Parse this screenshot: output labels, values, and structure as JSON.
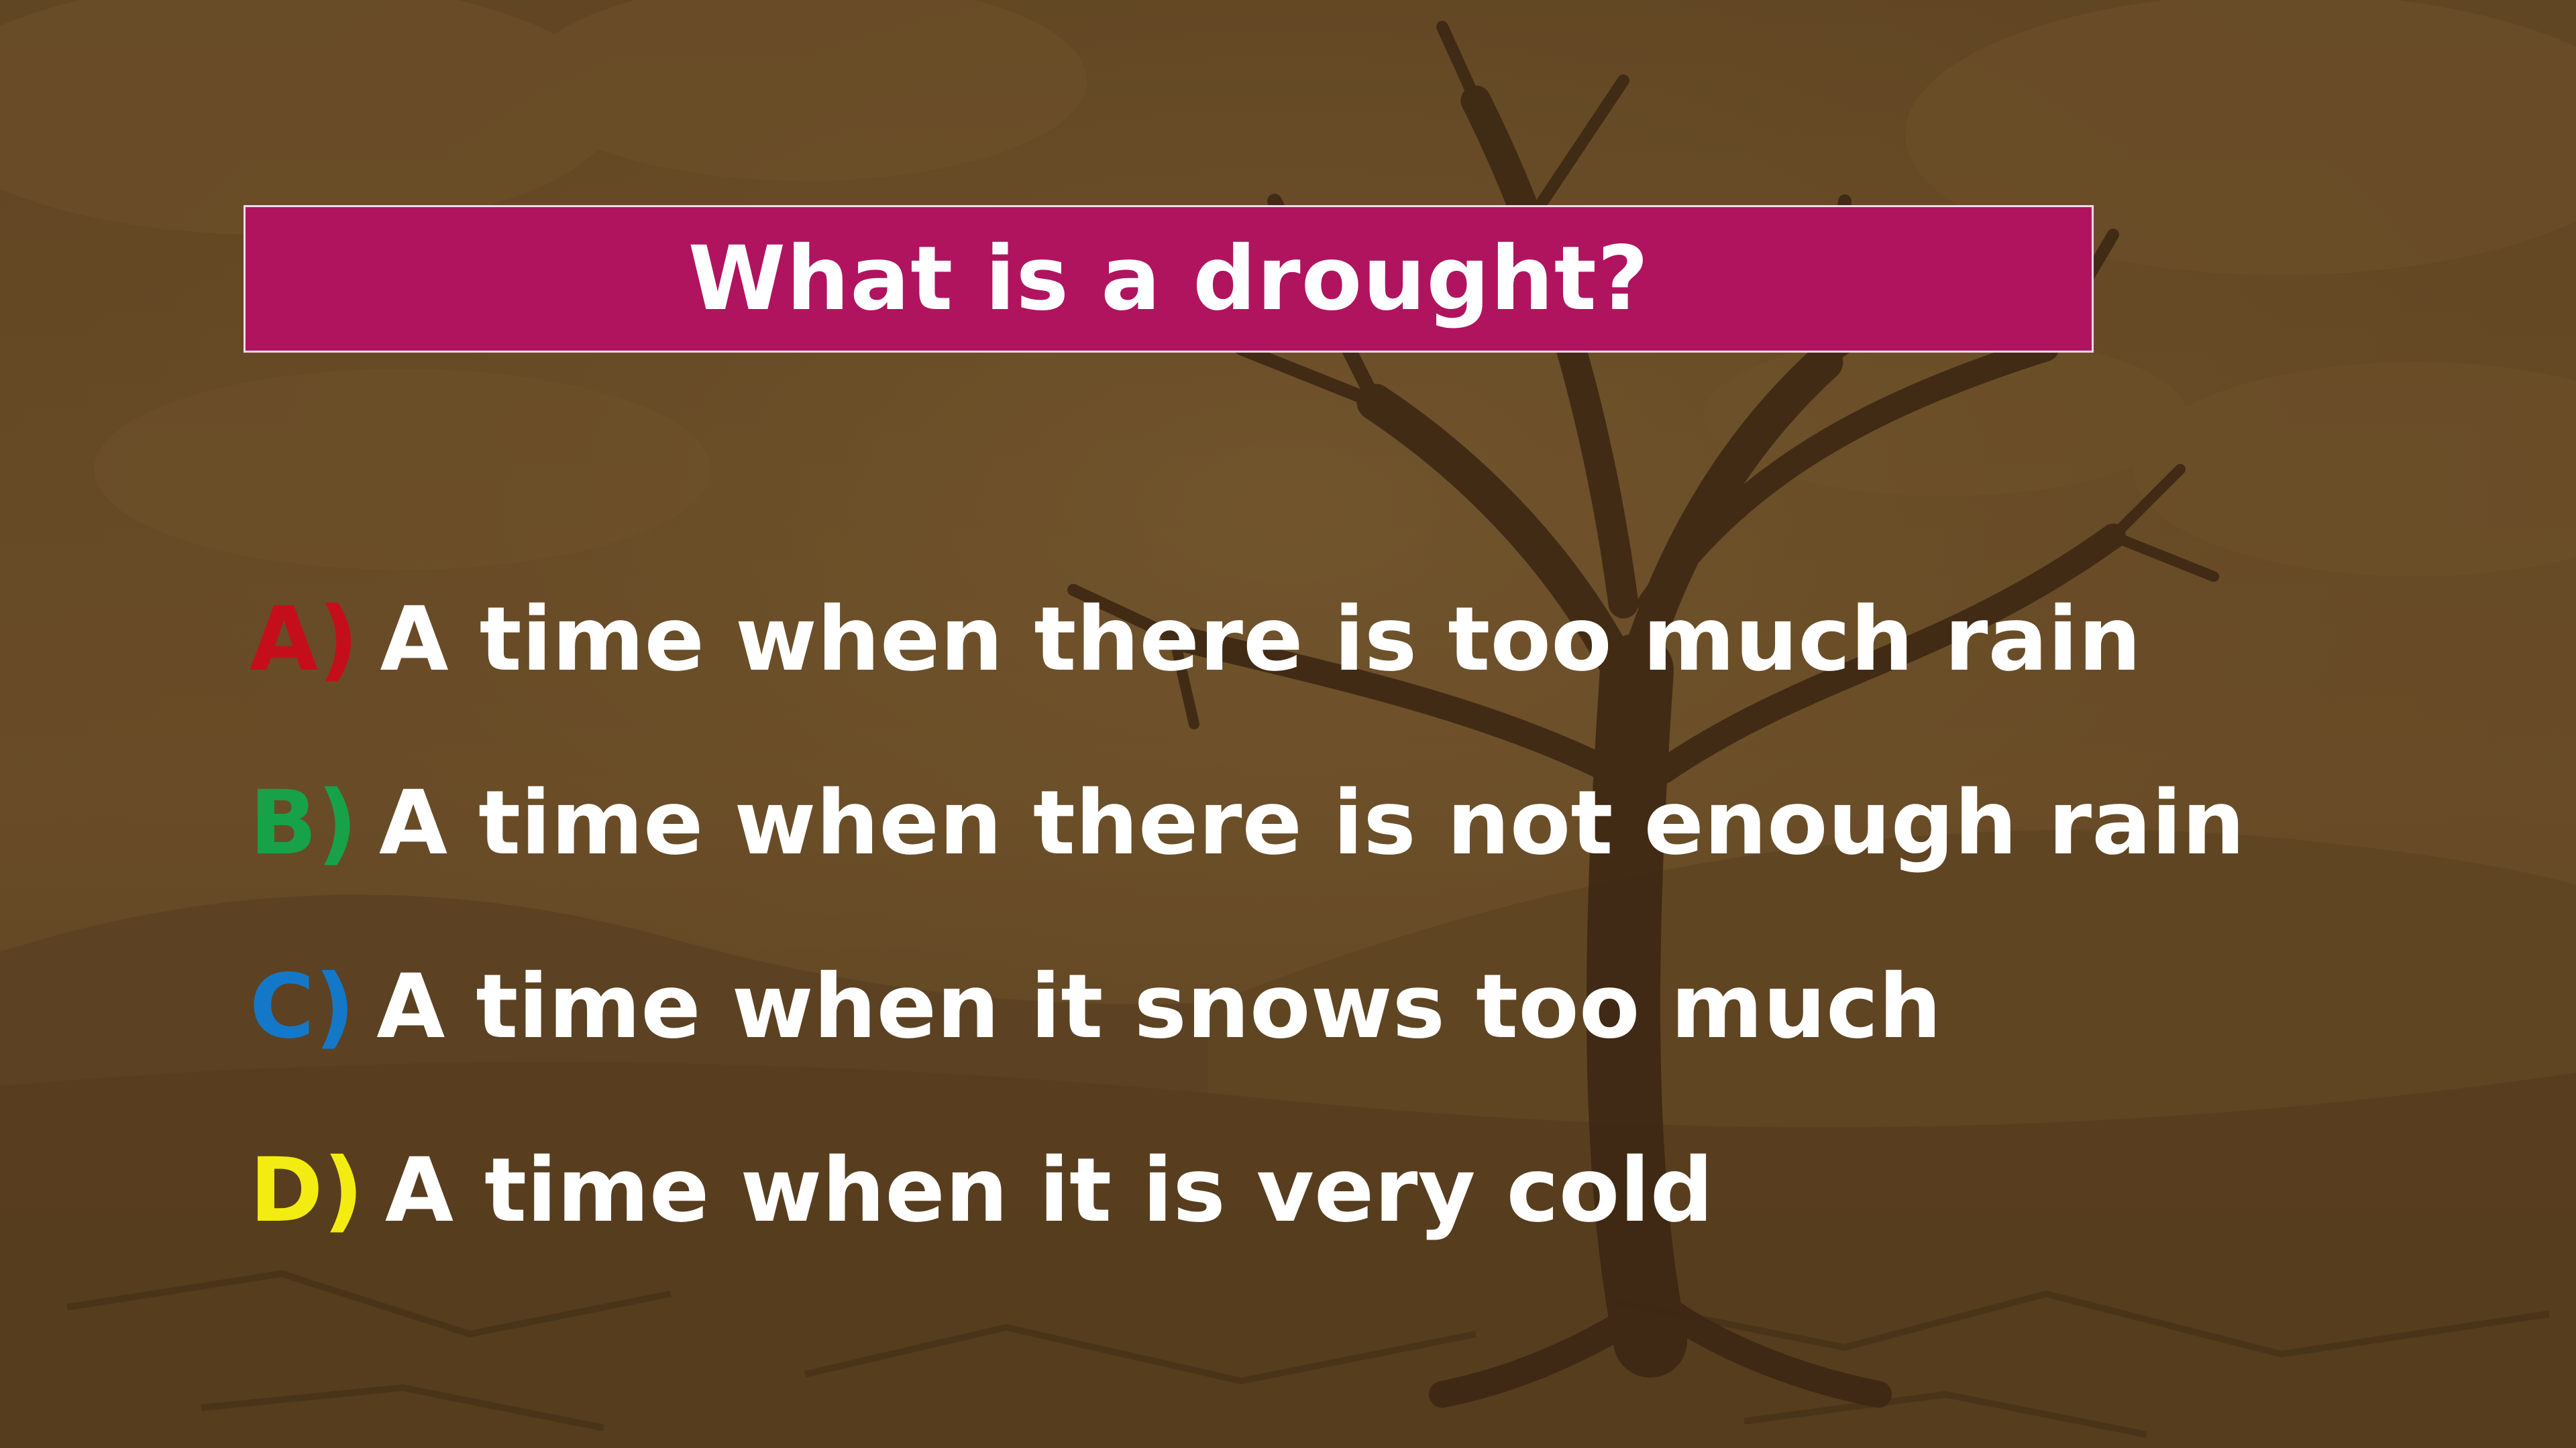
{
  "quiz": {
    "question": "What is a drought?",
    "options": [
      {
        "letter": "A)",
        "text": "A time when there is too much rain",
        "color": "#c40f1a"
      },
      {
        "letter": "B)",
        "text": "A time when there is not enough rain",
        "color": "#17a24a"
      },
      {
        "letter": "C)",
        "text": "A time when it snows too much",
        "color": "#1478c8"
      },
      {
        "letter": "D)",
        "text": "A time when it is very cold",
        "color": "#f2ec12"
      }
    ]
  },
  "theme": {
    "question_bg": "#b0145f",
    "background_tint": "#6b4e2a"
  }
}
